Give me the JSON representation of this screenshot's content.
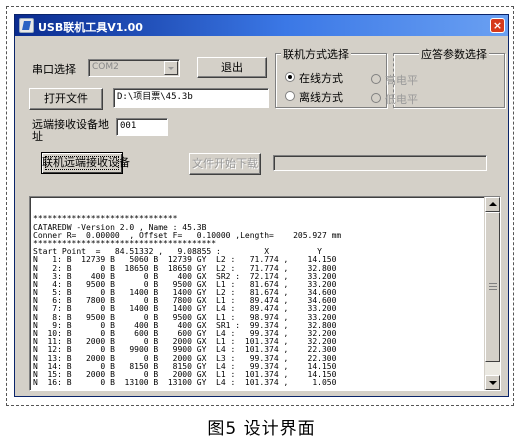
{
  "window": {
    "title": "USB联机工具V1.00",
    "close_symbol": "×"
  },
  "serial": {
    "label": "串口选择",
    "selected": "COM2",
    "exit_button": "退出"
  },
  "file": {
    "open_button": "打开文件",
    "path_value": "D:\\项目票\\45.3b"
  },
  "remote": {
    "address_label_line1": "远端接收设备地",
    "address_label_line2": "址",
    "address_value": "001",
    "connect_button": "联机远端接收设备",
    "download_button": "文件开始下载",
    "progress_value": ""
  },
  "mode_group": {
    "title": "联机方式选择",
    "options": [
      {
        "label": "在线方式",
        "selected": true
      },
      {
        "label": "离线方式",
        "selected": false
      }
    ]
  },
  "response_group": {
    "title": "应答参数选择",
    "options": [
      {
        "label": "高电平",
        "selected": false
      },
      {
        "label": "低电平",
        "selected": false
      }
    ]
  },
  "output": {
    "lines": [
      "",
      "",
      "******************************",
      "CATAREDW -Version 2.0 , Name : 45.3B",
      "Conner R=  0.00000  , Offset F=   0.10000 ,Length=    205.927 mm",
      "**************************************",
      "Start Point  =   84.51332 ,   9.08855 :         X          Y",
      "N   1: B  12739 B   5060 B  12739 GY  L2 :   71.774 ,    14.150",
      "N   2: B      0 B  18650 B  18650 GY  L2 :   71.774 ,    32.800",
      "N   3: B    400 B      0 B    400 GX  SR2 :  72.174 ,    33.200",
      "N   4: B   9500 B      0 B   9500 GX  L1 :   81.674 ,    33.200",
      "N   5: B      0 B   1400 B   1400 GY  L2 :   81.674 ,    34.600",
      "N   6: B   7800 B      0 B   7800 GX  L1 :   89.474 ,    34.600",
      "N   7: B      0 B   1400 B   1400 GY  L4 :   89.474 ,    33.200",
      "N   8: B   9500 B      0 B   9500 GX  L1 :   98.974 ,    33.200",
      "N   9: B      0 B    400 B    400 GX  SR1 :  99.374 ,    32.800",
      "N  10: B      0 B    600 B    600 GY  L4 :   99.374 ,    32.200",
      "N  11: B   2000 B      0 B   2000 GX  L1 :  101.374 ,    32.200",
      "N  12: B      0 B   9900 B   9900 GY  L4 :  101.374 ,    22.300",
      "N  13: B   2000 B      0 B   2000 GX  L3 :   99.374 ,    22.300",
      "N  14: B      0 B   8150 B   8150 GY  L4 :   99.374 ,    14.150",
      "N  15: B   2000 B      0 B   2000 GX  L1 :  101.374 ,    14.150",
      "N  16: B      0 B  13100 B  13100 GY  L4 :  101.374 ,     1.050"
    ]
  },
  "caption": "图5  设计界面"
}
